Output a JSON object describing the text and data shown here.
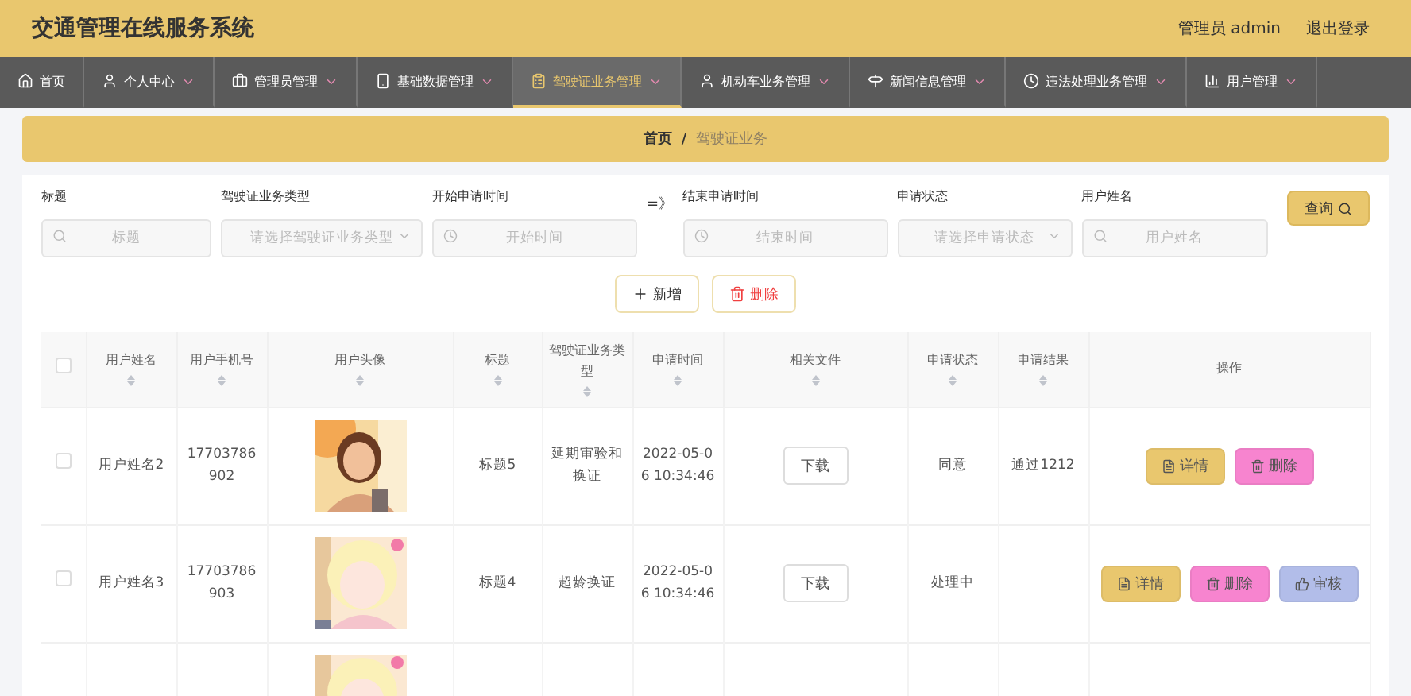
{
  "header": {
    "title": "交通管理在线服务系统",
    "user_label": "管理员 admin",
    "logout": "退出登录"
  },
  "nav": [
    {
      "label": "首页",
      "selected": false,
      "has_menu": false
    },
    {
      "label": "个人中心",
      "selected": false,
      "has_menu": true
    },
    {
      "label": "管理员管理",
      "selected": false,
      "has_menu": true
    },
    {
      "label": "基础数据管理",
      "selected": false,
      "has_menu": true
    },
    {
      "label": "驾驶证业务管理",
      "selected": true,
      "has_menu": true
    },
    {
      "label": "机动车业务管理",
      "selected": false,
      "has_menu": true
    },
    {
      "label": "新闻信息管理",
      "selected": false,
      "has_menu": true
    },
    {
      "label": "违法处理业务管理",
      "selected": false,
      "has_menu": true
    },
    {
      "label": "用户管理",
      "selected": false,
      "has_menu": true
    }
  ],
  "breadcrumb": [
    {
      "label": "首页",
      "selected": false
    },
    {
      "label": "驾驶证业务",
      "selected": true
    }
  ],
  "breadcrumb_separator": "/",
  "filters": [
    {
      "label": "标题",
      "placeholder": "标题",
      "kind": "text"
    },
    {
      "label": "驾驶证业务类型",
      "placeholder": "请选择驾驶证业务类型",
      "kind": "select"
    },
    {
      "label": "开始申请时间",
      "placeholder": "开始时间",
      "kind": "date"
    },
    {
      "label": "结束申请时间",
      "placeholder": "结束时间",
      "kind": "date"
    },
    {
      "label": "申请状态",
      "placeholder": "请选择申请状态",
      "kind": "select"
    },
    {
      "label": "用户姓名",
      "placeholder": "用户姓名",
      "kind": "text"
    }
  ],
  "range_separator": "=》",
  "search_button": "查询",
  "add_button": "新增",
  "delete_button": "删除",
  "table": {
    "all_checked": false,
    "columns": [
      {
        "kind": "check"
      },
      {
        "label": "用户姓名",
        "kind": "sort"
      },
      {
        "label": "用户手机号",
        "kind": "sort"
      },
      {
        "label": "用户头像",
        "kind": "sort"
      },
      {
        "label": "标题",
        "kind": "sort"
      },
      {
        "label": "驾驶证业务类型",
        "kind": "sort"
      },
      {
        "label": "申请时间",
        "kind": "sort"
      },
      {
        "label": "相关文件",
        "kind": "sort"
      },
      {
        "label": "申请状态",
        "kind": "sort"
      },
      {
        "label": "申请结果",
        "kind": "sort"
      },
      {
        "label": "操作",
        "kind": "plain"
      }
    ],
    "rows": [
      {
        "checked": false,
        "name": "用户姓名2",
        "phone": "17703786902",
        "avatar": {
          "kind": "picture"
        },
        "title": "标题5",
        "type": "延期审验和换证",
        "time": "2022-05-06 10:34:46",
        "file": "下载",
        "status": "同意",
        "result": "通过1212",
        "actions": [
          {
            "label": "详情",
            "kind": "detail"
          },
          {
            "label": "删除",
            "kind": "delete"
          }
        ]
      },
      {
        "checked": false,
        "name": "用户姓名3",
        "phone": "17703786903",
        "avatar": {
          "kind": "picture"
        },
        "title": "标题4",
        "type": "超龄换证",
        "time": "2022-05-06 10:34:46",
        "file": "下载",
        "status": "处理中",
        "actions": [
          {
            "label": "详情",
            "kind": "detail"
          },
          {
            "label": "删除",
            "kind": "delete"
          },
          {
            "label": "审核",
            "kind": "review"
          }
        ]
      },
      {
        "avatar": {
          "kind": "picture"
        }
      }
    ]
  }
}
